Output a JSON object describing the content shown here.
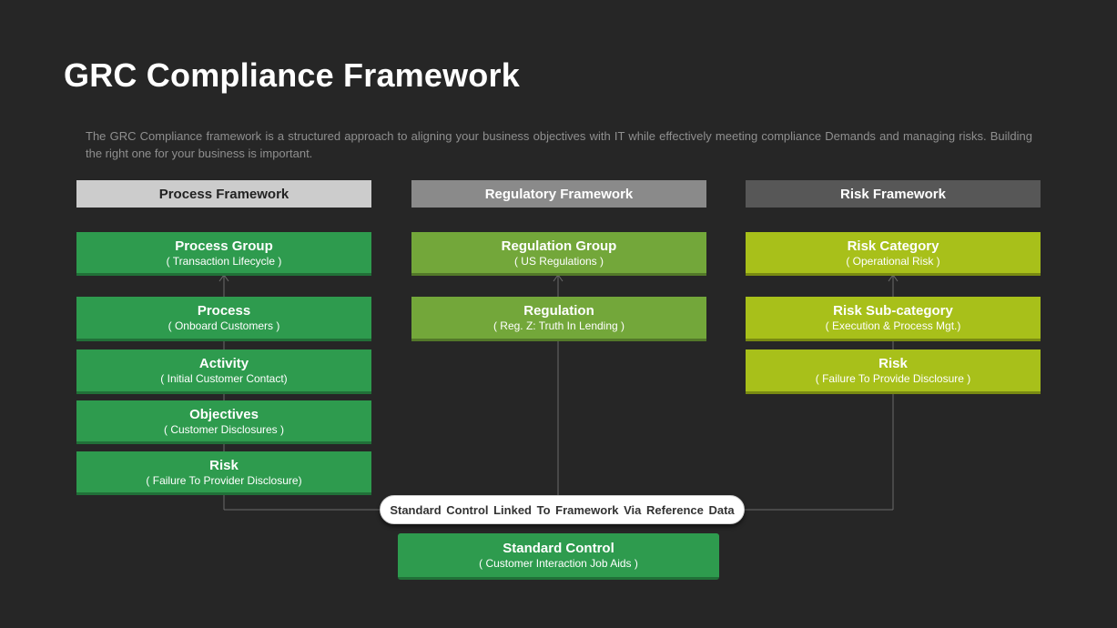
{
  "title": "GRC Compliance Framework",
  "description": "The GRC Compliance framework is a structured approach to aligning your business objectives with IT while effectively meeting compliance Demands and managing risks. Building the right one for your business is important.",
  "columns": [
    {
      "header": "Process Framework",
      "header_bg": "#cccccc",
      "header_color": "#222222",
      "box_color": "#2e9b4e",
      "boxes": [
        {
          "title": "Process Group",
          "sub": "( Transaction Lifecycle )"
        },
        {
          "title": "Process",
          "sub": "( Onboard Customers )"
        },
        {
          "title": "Activity",
          "sub": "( Initial Customer Contact)"
        },
        {
          "title": "Objectives",
          "sub": "( Customer Disclosures )"
        },
        {
          "title": "Risk",
          "sub": "( Failure To Provider Disclosure)"
        }
      ]
    },
    {
      "header": "Regulatory Framework",
      "header_bg": "#8a8a8a",
      "header_color": "#ffffff",
      "box_color": "#73a73a",
      "boxes": [
        {
          "title": "Regulation Group",
          "sub": "( US Regulations )"
        },
        {
          "title": "Regulation",
          "sub": "( Reg. Z: Truth In Lending )"
        }
      ]
    },
    {
      "header": "Risk Framework",
      "header_bg": "#575757",
      "header_color": "#ffffff",
      "box_color": "#a8c01a",
      "boxes": [
        {
          "title": "Risk Category",
          "sub": "( Operational Risk )"
        },
        {
          "title": "Risk Sub-category",
          "sub": "( Execution & Process Mgt.)"
        },
        {
          "title": "Risk",
          "sub": "( Failure To Provide Disclosure )"
        }
      ]
    }
  ],
  "link_label": "Standard Control Linked To Framework Via Reference Data",
  "standard_control": {
    "title": "Standard Control",
    "sub": "( Customer Interaction Job Aids )"
  },
  "colors": {
    "background": "#262626",
    "connector": "#6b6b6b"
  }
}
